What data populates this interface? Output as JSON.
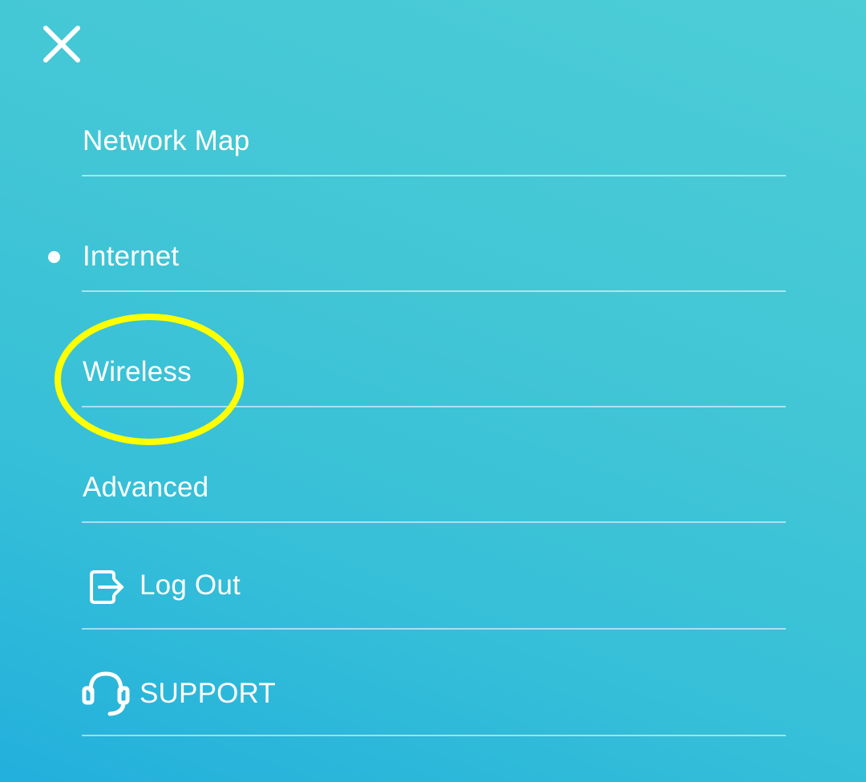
{
  "colors": {
    "background_top": "#4dcdd6",
    "background_bottom": "#22b0dc",
    "text": "#ffffff",
    "highlight": "#ffff00"
  },
  "header": {
    "close_icon": "close-x-icon"
  },
  "menu": {
    "items": [
      {
        "label": "Network Map",
        "active": false
      },
      {
        "label": "Internet",
        "active": true
      },
      {
        "label": "Wireless",
        "active": false,
        "highlighted": true
      },
      {
        "label": "Advanced",
        "active": false
      },
      {
        "label": "Log Out",
        "icon": "logout-icon"
      },
      {
        "label": "SUPPORT",
        "icon": "headset-icon"
      }
    ]
  }
}
